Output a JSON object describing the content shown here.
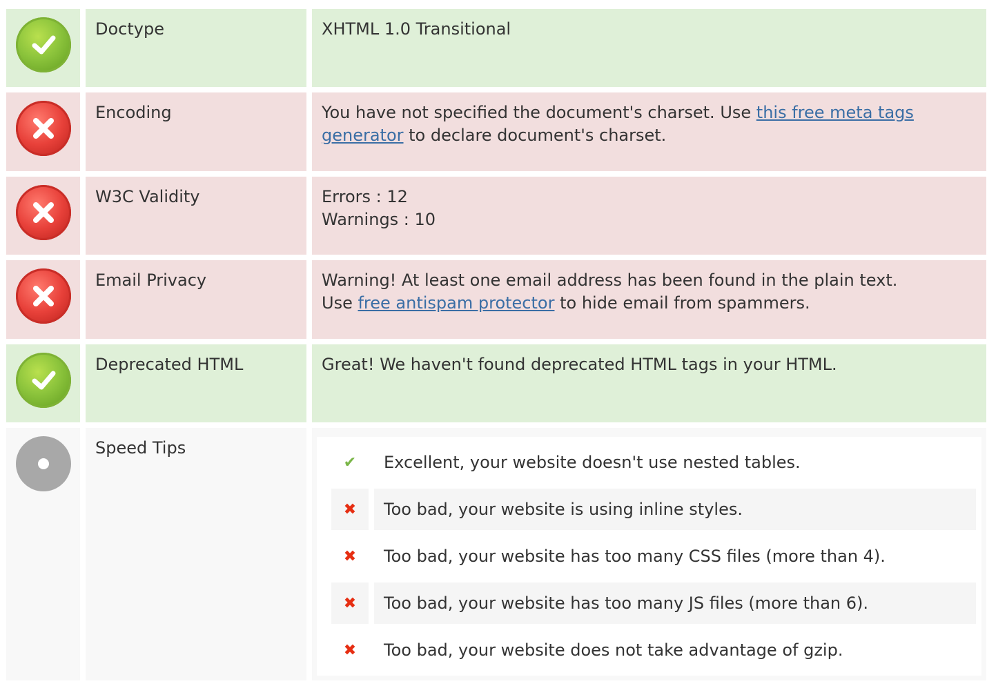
{
  "rows": [
    {
      "status": "ok",
      "label": "Doctype",
      "value": "XHTML 1.0 Transitional"
    },
    {
      "status": "error",
      "label": "Encoding",
      "value_before": "You have not specified the document's charset. Use ",
      "link": "this free meta tags generator",
      "value_after": " to declare document's charset."
    },
    {
      "status": "error",
      "label": "W3C Validity",
      "lines": [
        "Errors : 12",
        "Warnings : 10"
      ]
    },
    {
      "status": "error",
      "label": "Email Privacy",
      "line1": "Warning! At least one email address has been found in the plain text.",
      "value_before": "Use ",
      "link": "free antispam protector",
      "value_after": " to hide email from spammers."
    },
    {
      "status": "ok",
      "label": "Deprecated HTML",
      "value": "Great! We haven't found deprecated HTML tags in your HTML."
    },
    {
      "status": "neutral",
      "label": "Speed Tips"
    }
  ],
  "speed_tips": [
    {
      "status": "ok",
      "mark": "✔",
      "text": "Excellent, your website doesn't use nested tables."
    },
    {
      "status": "bad",
      "mark": "✖",
      "text": "Too bad, your website is using inline styles."
    },
    {
      "status": "bad",
      "mark": "✖",
      "text": "Too bad, your website has too many CSS files (more than 4)."
    },
    {
      "status": "bad",
      "mark": "✖",
      "text": "Too bad, your website has too many JS files (more than 6)."
    },
    {
      "status": "bad",
      "mark": "✖",
      "text": "Too bad, your website does not take advantage of gzip."
    }
  ],
  "colors": {
    "ok_bg": "#dff0d8",
    "error_bg": "#f2dede",
    "neutral_bg": "#f8f8f8",
    "link": "#3a6ea5",
    "tip_ok": "#7ab648",
    "tip_bad": "#e62e12"
  },
  "icons": {
    "ok": "check-badge-icon",
    "error": "cross-badge-icon",
    "neutral": "info-dot-icon"
  }
}
